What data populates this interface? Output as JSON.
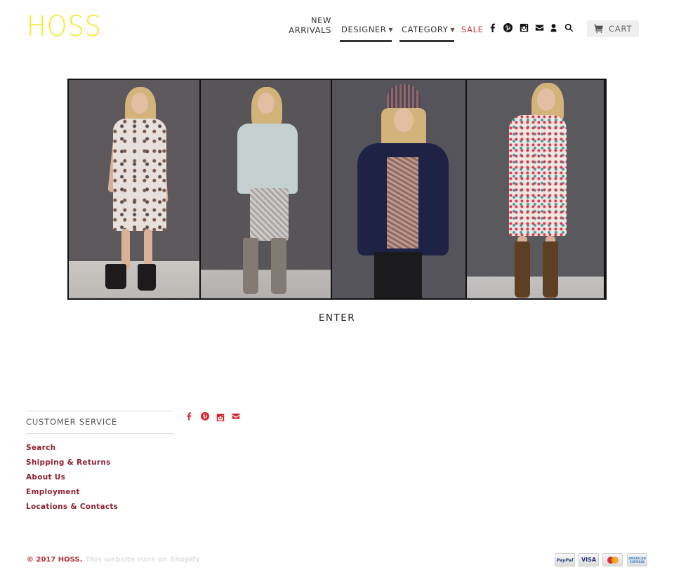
{
  "header": {
    "logo": "HOSS",
    "brand_color": "#f2e92a",
    "nav": [
      {
        "label_line1": "NEW",
        "label_line2": "ARRIVALS"
      },
      {
        "label": "DESIGNER",
        "caret": "▼",
        "active": true
      },
      {
        "label": "CATEGORY",
        "caret": "▼",
        "active": true
      },
      {
        "label": "SALE",
        "color": "#c8393d"
      }
    ],
    "icons": [
      "facebook-icon",
      "pinterest-icon",
      "instagram-icon",
      "mail-icon",
      "account-icon",
      "search-icon"
    ],
    "cart": {
      "label": "CART",
      "icon": "cart-icon"
    }
  },
  "hero": {
    "panels": [
      {
        "description": "Model in floral print midi dress with black ankle boots"
      },
      {
        "description": "Model in pale blue tie-neck blouse, sequin trousers and grey suede boots"
      },
      {
        "description": "Model in navy knit cardigan, sequin beanie and scarf"
      },
      {
        "description": "Model in multicolor floral dress with brown suede knee boots"
      }
    ],
    "enter_label": "ENTER"
  },
  "footer": {
    "section_title": "CUSTOMER SERVICE",
    "links": [
      "Search",
      "Shipping & Returns",
      "About Us",
      "Employment",
      "Locations & Contacts"
    ],
    "social_icons": [
      "facebook-icon",
      "pinterest-icon",
      "instagram-icon",
      "mail-icon"
    ],
    "accent_color": "#d9262e",
    "copyright": "© 2017 HOSS.",
    "powered_by": "This website runs on Shopify",
    "payment_methods": [
      "PayPal",
      "VISA",
      "MasterCard",
      "American Express"
    ],
    "amex_line1": "AMERICAN",
    "amex_line2": "EXPRESS"
  }
}
